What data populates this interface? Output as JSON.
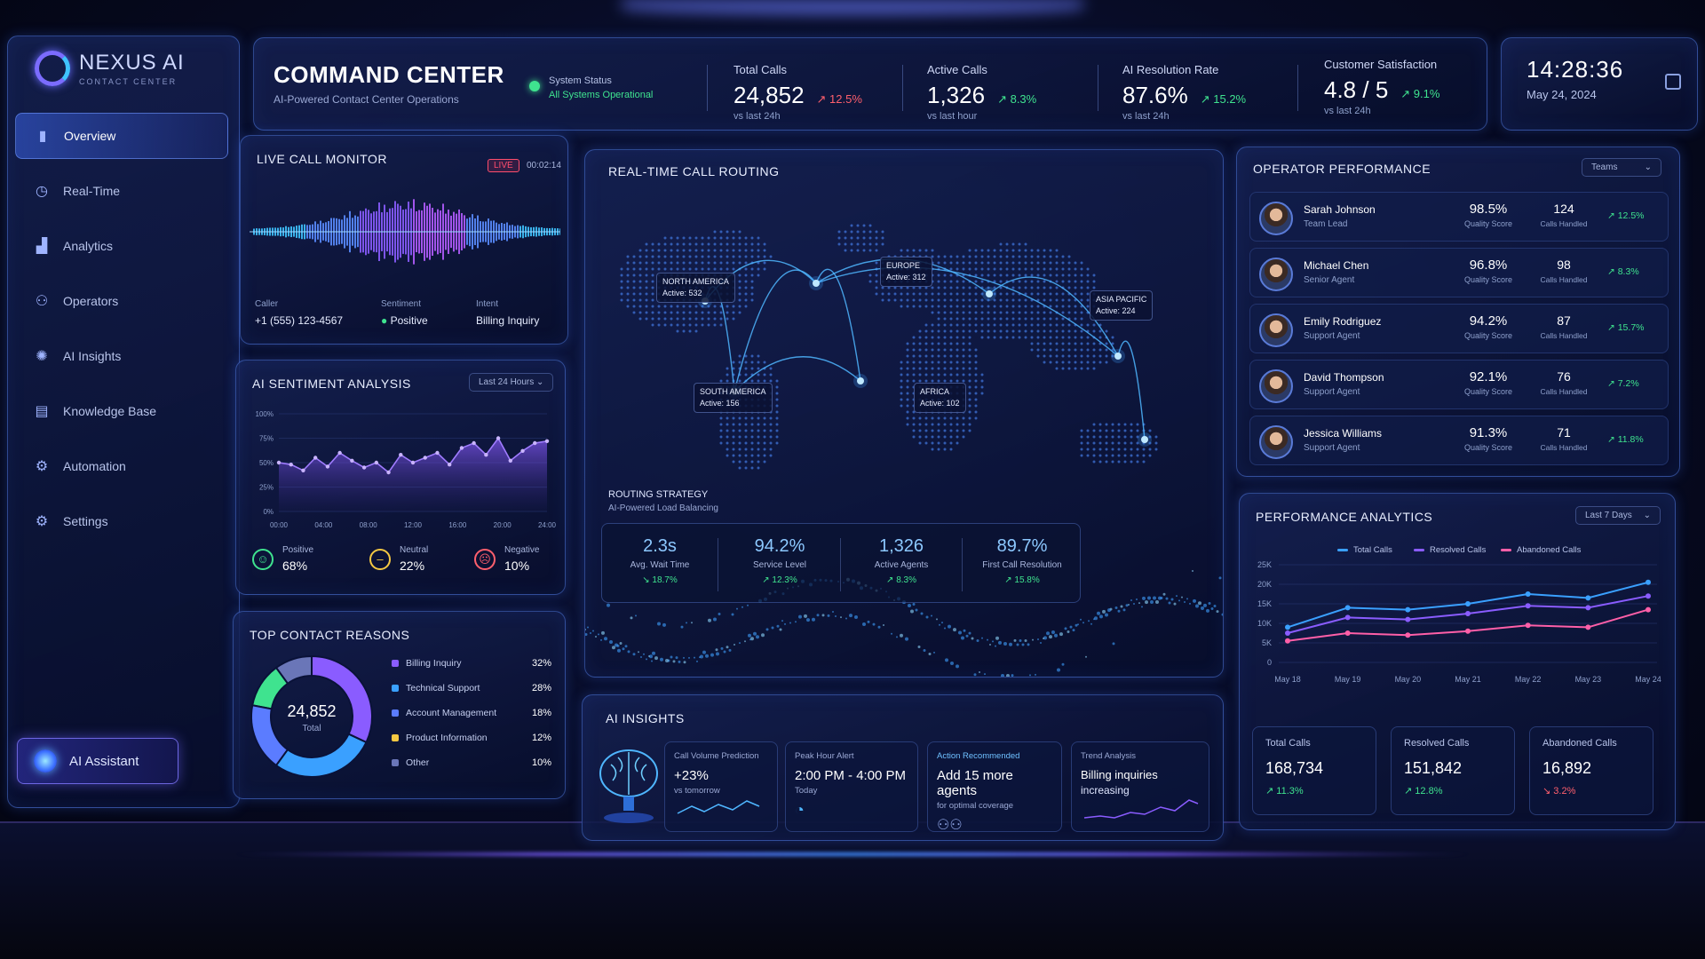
{
  "app": {
    "name": "NEXUS AI",
    "tagline": "CONTACT CENTER"
  },
  "sidebar": {
    "items": [
      {
        "label": "Overview",
        "icon": "bar-chart-icon",
        "active": true
      },
      {
        "label": "Real-Time",
        "icon": "clock-icon"
      },
      {
        "label": "Analytics",
        "icon": "analytics-icon"
      },
      {
        "label": "Operators",
        "icon": "users-icon"
      },
      {
        "label": "AI Insights",
        "icon": "lightbulb-icon"
      },
      {
        "label": "Knowledge Base",
        "icon": "document-icon"
      },
      {
        "label": "Automation",
        "icon": "cog-icon"
      },
      {
        "label": "Settings",
        "icon": "gear-icon"
      }
    ],
    "assistant_label": "AI Assistant"
  },
  "header": {
    "title": "COMMAND CENTER",
    "subtitle": "AI-Powered Contact Center Operations",
    "system_status_label": "System Status",
    "system_status_value": "All Systems Operational",
    "kpis": [
      {
        "label": "Total Calls",
        "value": "24,852",
        "delta": "12.5%",
        "note": "vs last 24h"
      },
      {
        "label": "Active Calls",
        "value": "1,326",
        "delta": "8.3%",
        "note": "vs last hour"
      },
      {
        "label": "AI Resolution Rate",
        "value": "87.6%",
        "delta": "15.2%",
        "note": "vs last 24h"
      },
      {
        "label": "Customer Satisfaction",
        "value": "4.8 / 5",
        "delta": "9.1%",
        "note": "vs last 24h"
      }
    ]
  },
  "clock": {
    "time": "14:28:36",
    "date": "May 24, 2024"
  },
  "live_monitor": {
    "title": "LIVE CALL MONITOR",
    "badge": "LIVE",
    "duration": "00:02:14",
    "caller_label": "Caller",
    "caller": "+1 (555) 123-4567",
    "sentiment_label": "Sentiment",
    "sentiment": "Positive",
    "intent_label": "Intent",
    "intent": "Billing Inquiry"
  },
  "sentiment": {
    "title": "AI SENTIMENT ANALYSIS",
    "range": "Last 24 Hours",
    "chart_data": {
      "type": "area",
      "x": [
        "00:00",
        "04:00",
        "08:00",
        "12:00",
        "16:00",
        "20:00",
        "24:00"
      ],
      "y_ticks": [
        "100%",
        "75%",
        "50%",
        "25%",
        "0%"
      ],
      "ylim": [
        0,
        100
      ],
      "values": [
        50,
        48,
        42,
        55,
        46,
        60,
        52,
        45,
        50,
        40,
        58,
        50,
        55,
        60,
        48,
        65,
        70,
        58,
        75,
        52,
        62,
        70,
        72
      ]
    },
    "items": [
      {
        "label": "Positive",
        "value": "68%",
        "color": "#3fe38f",
        "icon": "smile-icon"
      },
      {
        "label": "Neutral",
        "value": "22%",
        "color": "#f5c842",
        "icon": "neutral-face-icon"
      },
      {
        "label": "Negative",
        "value": "10%",
        "color": "#ff5f6d",
        "icon": "sad-face-icon"
      }
    ]
  },
  "reasons": {
    "title": "TOP CONTACT REASONS",
    "total": "24,852",
    "total_label": "Total",
    "chart_data": {
      "type": "pie",
      "categories": [
        "Billing Inquiry",
        "Technical Support",
        "Account Management",
        "Product Information",
        "Other"
      ],
      "values": [
        32,
        28,
        18,
        12,
        10
      ],
      "colors": [
        "#8a5cff",
        "#3aa0ff",
        "#5b7cff",
        "#3fe38f",
        "#6a76b8"
      ]
    },
    "rows": [
      {
        "label": "Billing Inquiry",
        "pct": "32%",
        "color": "#8a5cff"
      },
      {
        "label": "Technical Support",
        "pct": "28%",
        "color": "#3aa0ff"
      },
      {
        "label": "Account Management",
        "pct": "18%",
        "color": "#5b7cff"
      },
      {
        "label": "Product Information",
        "pct": "12%",
        "color": "#f5c842"
      },
      {
        "label": "Other",
        "pct": "10%",
        "color": "#6a76b8"
      }
    ]
  },
  "routing": {
    "title": "REAL-TIME CALL ROUTING",
    "regions": [
      {
        "name": "NORTH AMERICA",
        "active": "Active: 532"
      },
      {
        "name": "EUROPE",
        "active": "Active: 312"
      },
      {
        "name": "ASIA PACIFIC",
        "active": "Active: 224"
      },
      {
        "name": "SOUTH AMERICA",
        "active": "Active: 156"
      },
      {
        "name": "AFRICA",
        "active": "Active: 102"
      }
    ],
    "strategy_title": "ROUTING STRATEGY",
    "strategy_sub": "AI-Powered Load Balancing",
    "metrics": [
      {
        "value": "2.3s",
        "label": "Avg. Wait Time",
        "delta": "18.7%",
        "dir": "down"
      },
      {
        "value": "94.2%",
        "label": "Service Level",
        "delta": "12.3%",
        "dir": "up"
      },
      {
        "value": "1,326",
        "label": "Active Agents",
        "delta": "8.3%",
        "dir": "up"
      },
      {
        "value": "89.7%",
        "label": "First Call Resolution",
        "delta": "15.8%",
        "dir": "up"
      }
    ]
  },
  "insights": {
    "title": "AI INSIGHTS",
    "cards": [
      {
        "label": "Call Volume Prediction",
        "value": "+23%",
        "sub": "vs tomorrow"
      },
      {
        "label": "Peak Hour Alert",
        "value": "2:00 PM - 4:00 PM",
        "sub": "Today"
      },
      {
        "label": "Action Recommended",
        "value": "Add 15 more agents",
        "sub": "for optimal coverage"
      },
      {
        "label": "Trend Analysis",
        "value": "Billing inquiries",
        "sub": "increasing"
      }
    ]
  },
  "operators": {
    "title": "OPERATOR PERFORMANCE",
    "filter": "Teams",
    "quality_label": "Quality Score",
    "calls_label": "Calls Handled",
    "rows": [
      {
        "name": "Sarah Johnson",
        "role": "Team Lead",
        "quality": "98.5%",
        "calls": "124",
        "delta": "12.5%"
      },
      {
        "name": "Michael Chen",
        "role": "Senior Agent",
        "quality": "96.8%",
        "calls": "98",
        "delta": "8.3%"
      },
      {
        "name": "Emily Rodriguez",
        "role": "Support Agent",
        "quality": "94.2%",
        "calls": "87",
        "delta": "15.7%"
      },
      {
        "name": "David Thompson",
        "role": "Support Agent",
        "quality": "92.1%",
        "calls": "76",
        "delta": "7.2%"
      },
      {
        "name": "Jessica Williams",
        "role": "Support Agent",
        "quality": "91.3%",
        "calls": "71",
        "delta": "11.8%"
      }
    ]
  },
  "performance": {
    "title": "PERFORMANCE ANALYTICS",
    "range": "Last 7 Days",
    "chart_data": {
      "type": "line",
      "x": [
        "May 18",
        "May 19",
        "May 20",
        "May 21",
        "May 22",
        "May 23",
        "May 24"
      ],
      "y_ticks": [
        "25K",
        "20K",
        "15K",
        "10K",
        "5K",
        "0"
      ],
      "ylim": [
        0,
        25000
      ],
      "series": [
        {
          "name": "Total Calls",
          "color": "#3aa0ff",
          "values": [
            9000,
            14000,
            13500,
            15000,
            17500,
            16500,
            20500
          ]
        },
        {
          "name": "Resolved Calls",
          "color": "#8a5cff",
          "values": [
            7500,
            11500,
            11000,
            12500,
            14500,
            14000,
            17000
          ]
        },
        {
          "name": "Abandoned Calls",
          "color": "#ff5fa8",
          "values": [
            5500,
            7500,
            7000,
            8000,
            9500,
            9000,
            13500
          ]
        }
      ]
    },
    "stats": [
      {
        "label": "Total Calls",
        "value": "168,734",
        "delta": "11.3%",
        "dir": "up"
      },
      {
        "label": "Resolved Calls",
        "value": "151,842",
        "delta": "12.8%",
        "dir": "up"
      },
      {
        "label": "Abandoned Calls",
        "value": "16,892",
        "delta": "3.2%",
        "dir": "down"
      }
    ]
  }
}
